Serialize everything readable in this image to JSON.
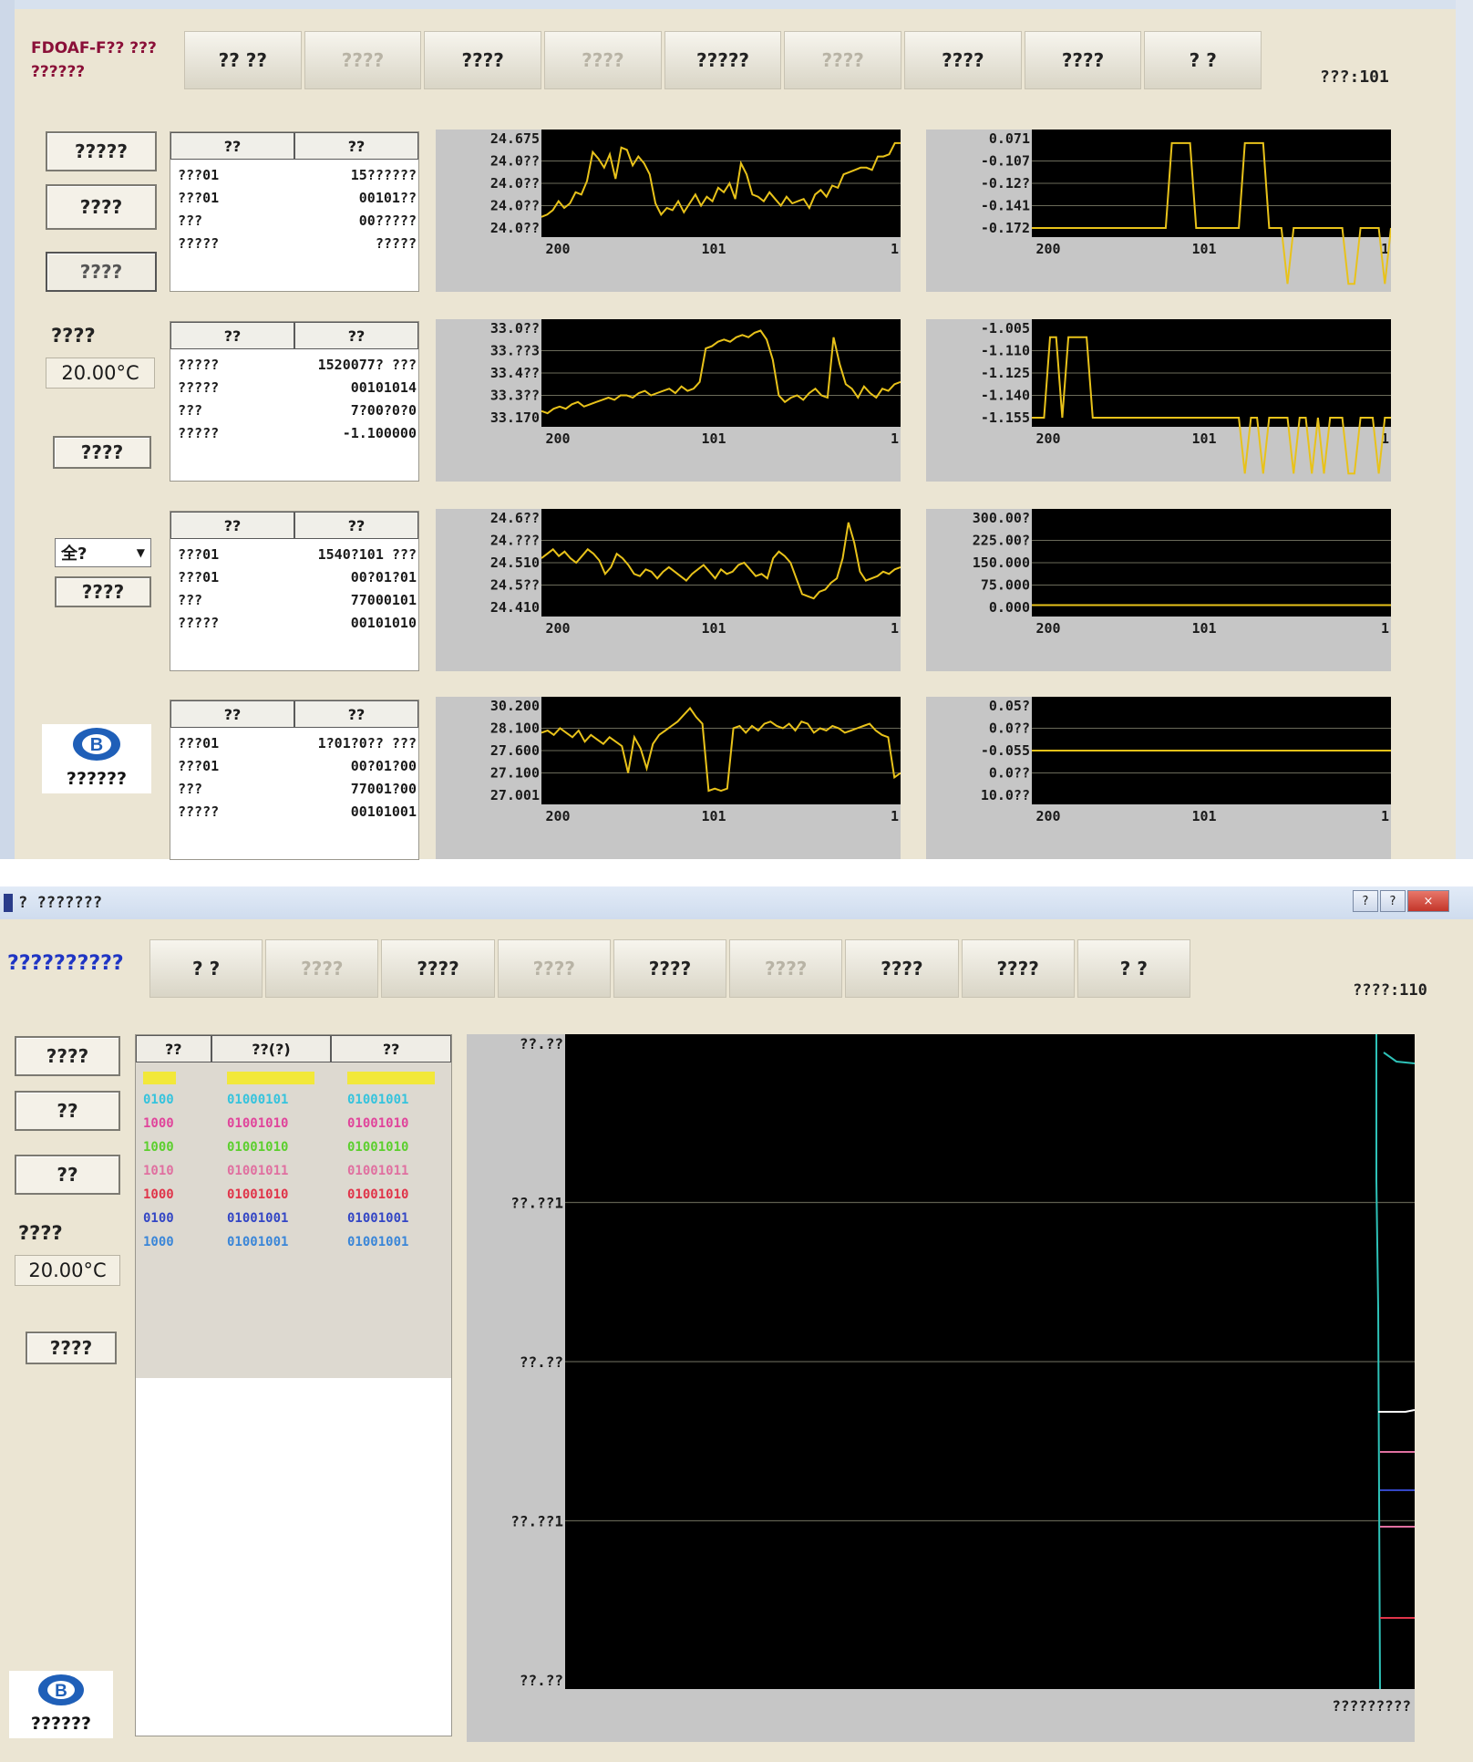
{
  "top": {
    "app_title_line1": "FDOAF-F?? ???",
    "app_title_line2": "??????",
    "clock": "???:101",
    "tabs": [
      {
        "label": "?? ??",
        "dim": false
      },
      {
        "label": "????",
        "dim": true
      },
      {
        "label": "????",
        "dim": false
      },
      {
        "label": "????",
        "dim": true
      },
      {
        "label": "?????",
        "dim": false
      },
      {
        "label": "????",
        "dim": true
      },
      {
        "label": "????",
        "dim": false
      },
      {
        "label": "????",
        "dim": false
      },
      {
        "label": "? ?",
        "dim": false
      }
    ],
    "buttons": {
      "b1": "?????",
      "b2": "????",
      "b3": "????"
    },
    "temp_label": "????",
    "temp_value": "20.00°C",
    "button4": "????",
    "dropdown_value": "全?",
    "button5": "????",
    "logo_text": "??????",
    "tables": [
      {
        "h1": "??",
        "h2": "??",
        "rows": [
          [
            "???01",
            "15??????"
          ],
          [
            "???01",
            "00101??"
          ],
          [
            "???",
            "00?????"
          ],
          [
            "?????",
            "?????"
          ]
        ]
      },
      {
        "h1": "??",
        "h2": "??",
        "rows": [
          [
            "?????",
            "1520077? ???"
          ],
          [
            "?????",
            "00101014"
          ],
          [
            "???",
            "7?00?0?0"
          ],
          [
            "?????",
            "-1.100000"
          ]
        ]
      },
      {
        "h1": "??",
        "h2": "??",
        "rows": [
          [
            "???01",
            "1540?101 ???"
          ],
          [
            "???01",
            "00?01?01"
          ],
          [
            "???",
            "77000101"
          ],
          [
            "?????",
            "00101010"
          ]
        ]
      },
      {
        "h1": "??",
        "h2": "??",
        "rows": [
          [
            "???01",
            "1?01?0?? ???"
          ],
          [
            "???01",
            "00?01?00"
          ],
          [
            "???",
            "77001?00"
          ],
          [
            "?????",
            "00101001"
          ]
        ]
      }
    ],
    "x_labels": {
      "start": "200",
      "mid": "101",
      "end": "1"
    },
    "charts": [
      {
        "name": "row1-left",
        "yticks": [
          "24.675",
          "24.0??",
          "24.0??",
          "24.0??",
          "24.0??"
        ],
        "ylim": [
          0,
          4
        ],
        "values": [
          0.5,
          0.6,
          0.8,
          1.2,
          0.9,
          1.1,
          1.6,
          1.5,
          2.1,
          3.4,
          3.1,
          2.7,
          3.3,
          2.2,
          3.6,
          3.5,
          2.8,
          3.2,
          2.9,
          2.4,
          1.1,
          0.6,
          0.9,
          0.8,
          1.2,
          0.7,
          1.1,
          1.5,
          1.0,
          1.4,
          1.2,
          1.8,
          1.6,
          2.0,
          1.3,
          2.9,
          2.4,
          1.5,
          1.4,
          1.2,
          1.6,
          1.3,
          1.0,
          1.4,
          1.1,
          1.2,
          1.3,
          0.9,
          1.5,
          1.7,
          1.4,
          1.9,
          1.8,
          2.4,
          2.5,
          2.6,
          2.7,
          2.7,
          2.6,
          3.2,
          3.2,
          3.3,
          3.8,
          3.8
        ]
      },
      {
        "name": "row1-right",
        "yticks": [
          "0.071",
          "-0.107",
          "-0.12?",
          "-0.141",
          "-0.172"
        ],
        "ylim": [
          0,
          4
        ],
        "values": [
          0,
          0,
          0,
          0,
          0,
          0,
          0,
          0,
          0,
          0,
          0,
          0,
          0,
          0,
          0,
          0,
          0,
          0,
          0,
          0,
          0,
          0,
          0,
          3.8,
          3.8,
          3.8,
          3.8,
          0,
          0,
          0,
          0,
          0,
          0,
          0,
          0,
          3.8,
          3.8,
          3.8,
          3.8,
          0,
          0,
          0,
          -2.5,
          0,
          0,
          0,
          0,
          0,
          0,
          0,
          0,
          0,
          -2.5,
          -2.5,
          0,
          0,
          0,
          0,
          -2.5,
          0
        ]
      },
      {
        "name": "row2-left",
        "yticks": [
          "33.0??",
          "33.??3",
          "33.4??",
          "33.3??",
          "33.170"
        ],
        "ylim": [
          0,
          4
        ],
        "values": [
          0.3,
          0.2,
          0.4,
          0.5,
          0.4,
          0.6,
          0.7,
          0.5,
          0.6,
          0.7,
          0.8,
          0.9,
          0.8,
          1.0,
          1.0,
          0.9,
          1.1,
          1.2,
          1.0,
          1.1,
          1.2,
          1.3,
          1.1,
          1.4,
          1.2,
          1.3,
          1.6,
          3.1,
          3.2,
          3.4,
          3.5,
          3.4,
          3.6,
          3.7,
          3.6,
          3.8,
          3.9,
          3.5,
          2.6,
          1.0,
          0.7,
          0.9,
          1.0,
          0.8,
          1.1,
          1.3,
          1.0,
          0.9,
          3.6,
          2.4,
          1.5,
          1.3,
          0.9,
          1.4,
          1.1,
          0.9,
          1.3,
          1.2,
          1.5,
          1.6
        ]
      },
      {
        "name": "row2-right",
        "yticks": [
          "-1.005",
          "-1.110",
          "-1.125",
          "-1.140",
          "-1.155"
        ],
        "ylim": [
          0,
          4
        ],
        "values": [
          0,
          0,
          0,
          3.6,
          3.6,
          0,
          3.6,
          3.6,
          3.6,
          3.6,
          0,
          0,
          0,
          0,
          0,
          0,
          0,
          0,
          0,
          0,
          0,
          0,
          0,
          0,
          0,
          0,
          0,
          0,
          0,
          0,
          0,
          0,
          0,
          0,
          0,
          -2.5,
          0,
          0,
          -2.5,
          0,
          0,
          0,
          0,
          -2.5,
          0,
          0,
          -2.5,
          0,
          -2.5,
          0,
          0,
          0,
          -2.5,
          -2.5,
          0,
          0,
          0,
          -2.5,
          0,
          0
        ]
      },
      {
        "name": "row3-left",
        "yticks": [
          "24.6??",
          "24.???",
          "24.510",
          "24.5??",
          "24.410"
        ],
        "ylim": [
          0,
          4
        ],
        "values": [
          2.2,
          2.4,
          2.6,
          2.3,
          2.5,
          2.2,
          2.0,
          2.3,
          2.6,
          2.4,
          2.1,
          1.5,
          1.8,
          2.4,
          2.2,
          1.9,
          1.5,
          1.4,
          1.7,
          1.6,
          1.3,
          1.6,
          1.8,
          1.6,
          1.4,
          1.2,
          1.5,
          1.7,
          1.9,
          1.6,
          1.3,
          1.7,
          1.5,
          1.6,
          1.9,
          2.0,
          1.7,
          1.4,
          1.5,
          1.3,
          2.2,
          2.5,
          2.3,
          2.0,
          1.3,
          0.6,
          0.5,
          0.4,
          0.7,
          0.8,
          1.1,
          1.3,
          2.2,
          3.8,
          2.9,
          1.6,
          1.2,
          1.3,
          1.4,
          1.6,
          1.5,
          1.7,
          1.8
        ]
      },
      {
        "name": "row3-right",
        "yticks": [
          "300.00?",
          "225.00?",
          "150.000",
          "75.000",
          "0.000"
        ],
        "ylim": [
          0,
          4
        ],
        "values": [
          0.1,
          0.1,
          0.1,
          0.1,
          0.1,
          0.1,
          0.1,
          0.1,
          0.1,
          0.1,
          0.1,
          0.1,
          0.1,
          0.1,
          0.1,
          0.1,
          0.1,
          0.1,
          0.1,
          0.1
        ]
      },
      {
        "name": "row4-left",
        "yticks": [
          "30.200",
          "28.100",
          "27.600",
          "27.100",
          "27.001"
        ],
        "ylim": [
          0,
          4
        ],
        "values": [
          2.8,
          2.9,
          2.7,
          3.0,
          2.8,
          2.6,
          2.9,
          2.4,
          2.7,
          2.5,
          2.3,
          2.6,
          2.4,
          2.2,
          1.0,
          2.6,
          2.1,
          1.2,
          2.3,
          2.7,
          2.9,
          3.1,
          3.3,
          3.6,
          3.9,
          3.5,
          3.2,
          0.2,
          0.3,
          0.2,
          0.3,
          3.0,
          3.1,
          2.8,
          3.1,
          2.9,
          3.2,
          3.3,
          3.1,
          3.0,
          3.2,
          2.9,
          3.3,
          3.2,
          2.8,
          3.0,
          2.9,
          3.1,
          3.0,
          2.8,
          2.9,
          3.0,
          3.1,
          3.2,
          2.9,
          2.7,
          2.6,
          0.8,
          1.0
        ]
      },
      {
        "name": "row4-right",
        "yticks": [
          "0.05?",
          "0.0??",
          "-0.055",
          "0.0??",
          "10.0??"
        ],
        "ylim": [
          0,
          4
        ],
        "values": [
          2.0,
          2.0,
          2.0,
          2.0,
          2.0,
          2.0,
          2.0,
          2.0,
          2.0,
          2.0,
          2.0,
          2.0,
          2.0,
          2.0,
          2.0,
          2.0,
          2.0,
          2.0,
          2.0,
          2.0
        ]
      }
    ]
  },
  "bottom": {
    "window_title": "? ???????",
    "window_controls": {
      "min": "?",
      "max": "?",
      "close": "×"
    },
    "app_title": "??????????",
    "clock": "????:110",
    "tabs": [
      {
        "label": "? ?",
        "dim": false
      },
      {
        "label": "????",
        "dim": true
      },
      {
        "label": "????",
        "dim": false
      },
      {
        "label": "????",
        "dim": true
      },
      {
        "label": "????",
        "dim": false
      },
      {
        "label": "????",
        "dim": true
      },
      {
        "label": "????",
        "dim": false
      },
      {
        "label": "????",
        "dim": false
      },
      {
        "label": "? ?",
        "dim": false
      }
    ],
    "buttons": {
      "b1": "????",
      "b2": "??",
      "b3": "??"
    },
    "temp_label": "????",
    "temp_value": "20.00°C",
    "button4": "????",
    "logo_text": "??????",
    "legend": {
      "headers": [
        "??",
        "??(?)",
        "??"
      ],
      "rows": [
        {
          "c1": "",
          "c2": "",
          "c3": "",
          "color": "#f2e83a"
        },
        {
          "c1": "0100",
          "c2": "01000101",
          "c3": "01001001",
          "color": "#35c3dd"
        },
        {
          "c1": "1000",
          "c2": "01001010",
          "c3": "01001010",
          "color": "#e0459b"
        },
        {
          "c1": "1000",
          "c2": "01001010",
          "c3": "01001010",
          "color": "#5ccf2e"
        },
        {
          "c1": "1010",
          "c2": "01001011",
          "c3": "01001011",
          "color": "#e070a0"
        },
        {
          "c1": "1000",
          "c2": "01001010",
          "c3": "01001010",
          "color": "#e0354a"
        },
        {
          "c1": "0100",
          "c2": "01001001",
          "c3": "01001001",
          "color": "#3346c5"
        },
        {
          "c1": "1000",
          "c2": "01001001",
          "c3": "01001001",
          "color": "#3a86d8"
        }
      ]
    },
    "big_chart": {
      "yticks": [
        "??.??",
        "??.??1",
        "??.??",
        "??.??1",
        "??.??"
      ],
      "x_label": "?????????"
    }
  }
}
